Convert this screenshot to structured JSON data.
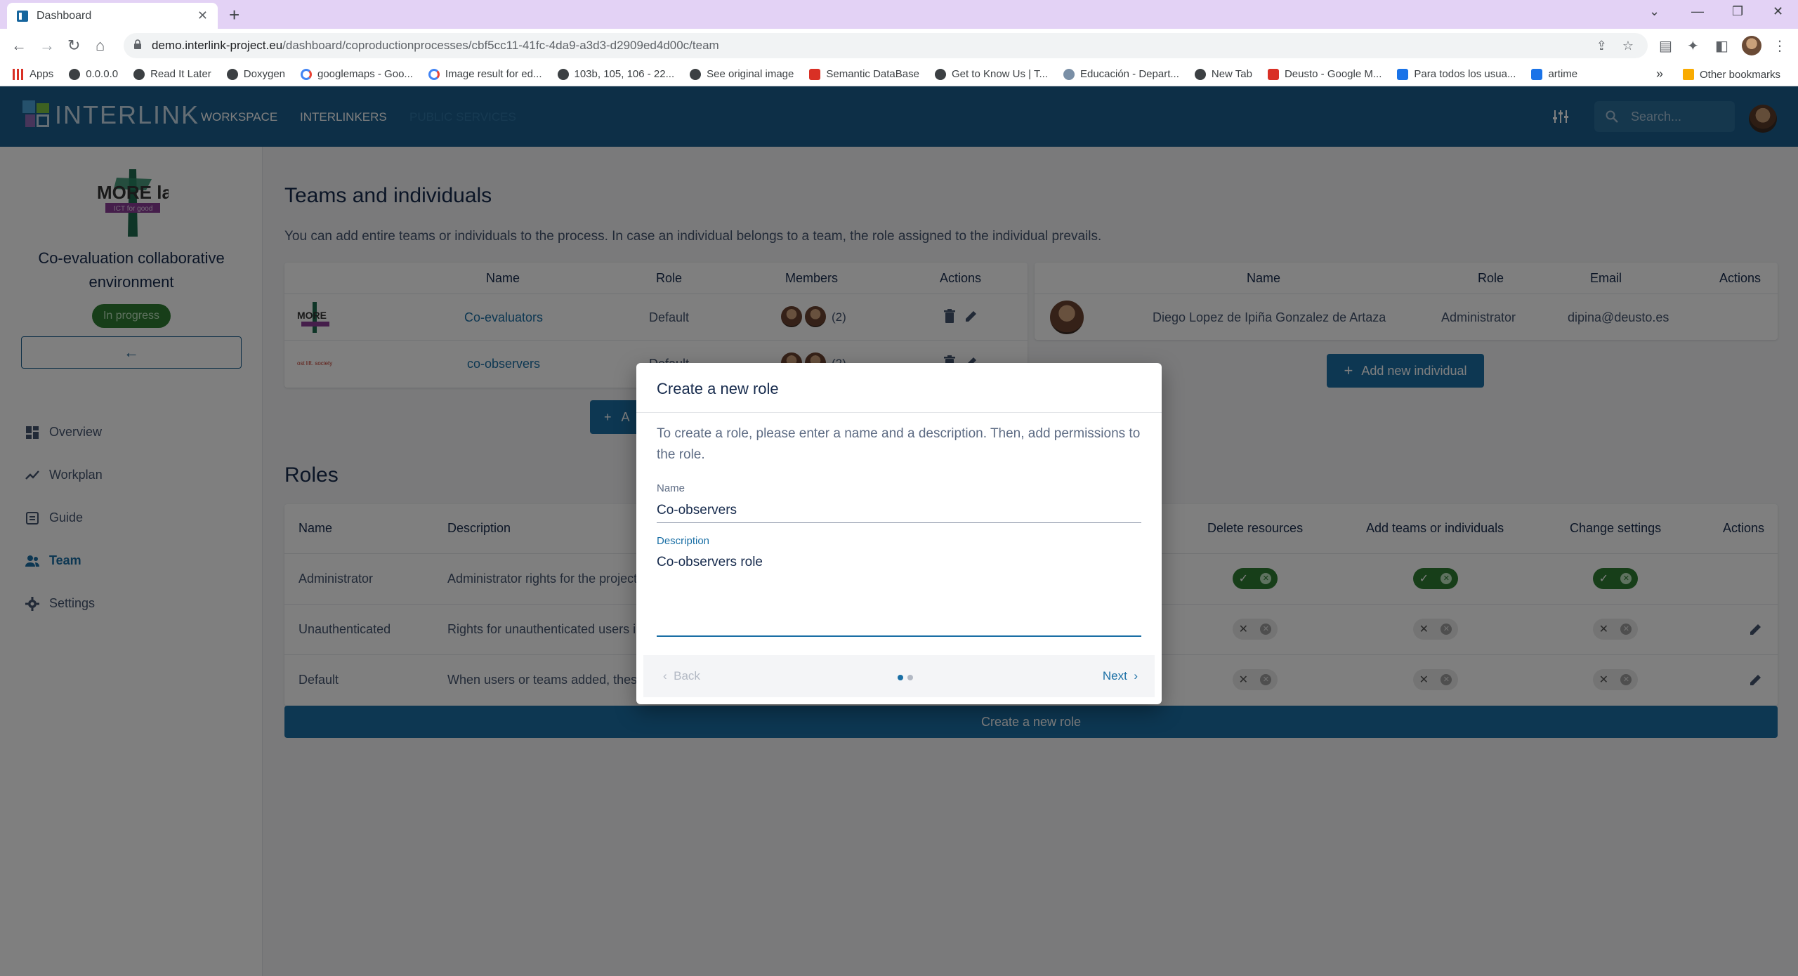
{
  "browser": {
    "tab_title": "Dashboard",
    "url_host": "demo.interlink-project.eu",
    "url_path": "/dashboard/coproductionprocesses/cbf5cc11-41fc-4da9-a3d3-d2909ed4d00c/team",
    "bookmarks": [
      {
        "label": "Apps",
        "icon": "apps-grid-icon"
      },
      {
        "label": "0.0.0.0",
        "icon": "globe-icon"
      },
      {
        "label": "Read It Later",
        "icon": "globe-icon"
      },
      {
        "label": "Doxygen",
        "icon": "globe-icon"
      },
      {
        "label": "googlemaps - Goo...",
        "icon": "google-icon"
      },
      {
        "label": "Image result for ed...",
        "icon": "google-icon"
      },
      {
        "label": "103b, 105, 106 - 22...",
        "icon": "globe-icon"
      },
      {
        "label": "See original image",
        "icon": "globe-icon"
      },
      {
        "label": "Semantic DataBase",
        "icon": "blogger-icon"
      },
      {
        "label": "Get to Know Us | T...",
        "icon": "site-icon"
      },
      {
        "label": "Educación - Depart...",
        "icon": "site-icon"
      },
      {
        "label": "New Tab",
        "icon": "globe-icon"
      },
      {
        "label": "Deusto - Google M...",
        "icon": "maps-pin-icon"
      },
      {
        "label": "Para todos los usua...",
        "icon": "shield-icon"
      },
      {
        "label": "artime",
        "icon": "shield-icon"
      }
    ],
    "other_bookmarks": "Other bookmarks"
  },
  "app": {
    "logo_text": "INTERLINK",
    "nav": [
      "WORKSPACE",
      "INTERLINKERS",
      "PUBLIC SERVICES"
    ],
    "search_placeholder": "Search..."
  },
  "sidebar": {
    "project_title": "Co-evaluation collaborative environment",
    "status": "In progress",
    "items": [
      {
        "label": "Overview",
        "icon": "dashboard-icon"
      },
      {
        "label": "Workplan",
        "icon": "timeline-icon"
      },
      {
        "label": "Guide",
        "icon": "guide-icon"
      },
      {
        "label": "Team",
        "icon": "team-icon"
      },
      {
        "label": "Settings",
        "icon": "gear-icon"
      }
    ]
  },
  "teams": {
    "heading": "Teams and individuals",
    "description": "You can add entire teams or individuals to the process. In case an individual belongs to a team, the role assigned to the individual prevails.",
    "team_columns": [
      "Name",
      "Role",
      "Members",
      "Actions"
    ],
    "team_rows": [
      {
        "name": "Co-evaluators",
        "role": "Default",
        "members": "(2)"
      },
      {
        "name": "co-observers",
        "role": "Default",
        "members": "(2)"
      }
    ],
    "individual_columns": [
      "Name",
      "Role",
      "Email",
      "Actions"
    ],
    "individual_rows": [
      {
        "name": "Diego Lopez de Ipiña Gonzalez de Artaza",
        "role": "Administrator",
        "email": "dipina@deusto.es"
      }
    ],
    "add_individual_label": "Add new individual",
    "add_team_label": "A"
  },
  "roles": {
    "heading": "Roles",
    "columns": [
      "Name",
      "Description",
      "Delete resources",
      "Add teams or individuals",
      "Change settings",
      "Actions"
    ],
    "rows": [
      {
        "name": "Administrator",
        "description": "Administrator rights for the project",
        "delete": true,
        "add": true,
        "change": true,
        "editable": false
      },
      {
        "name": "Unauthenticated",
        "description": "Rights for unauthenticated users in",
        "delete": false,
        "add": false,
        "change": false,
        "editable": true
      },
      {
        "name": "Default",
        "description": "When users or teams added, these",
        "delete": false,
        "add": false,
        "change": false,
        "editable": true
      }
    ],
    "create_label": "Create a new role"
  },
  "dialog": {
    "title": "Create a new role",
    "text": "To create a role, please enter a name and a description. Then, add permissions to the role.",
    "name_label": "Name",
    "name_value": "Co-observers",
    "description_label": "Description",
    "description_value": "Co-observers role",
    "back_label": "Back",
    "next_label": "Next",
    "step": 1,
    "total_steps": 2
  }
}
